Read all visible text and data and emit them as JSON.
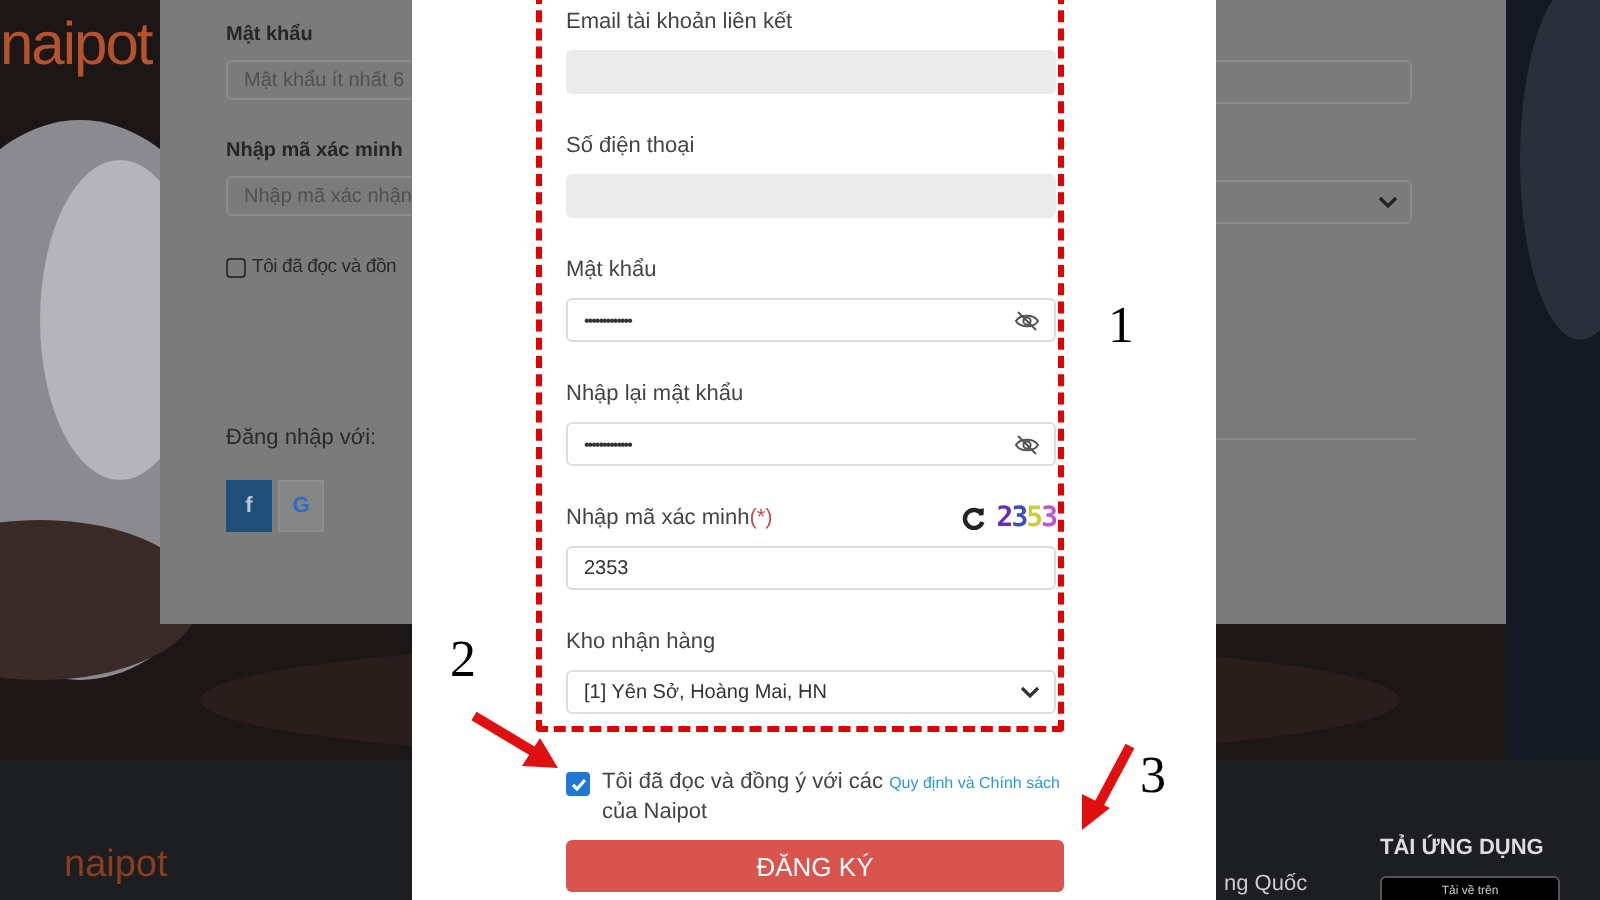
{
  "background_page": {
    "logo": "naipot",
    "form": {
      "fields": [
        {
          "label": "Mật khẩu",
          "placeholder": "Mật khẩu ít nhất 6",
          "kind": "input"
        },
        {
          "label": "Nhập mã xác minh",
          "placeholder": "Nhập mã xác nhận",
          "kind": "select"
        }
      ],
      "agree": {
        "label": "Tôi đã đọc và đồn",
        "checked": false
      },
      "login_with": "Đăng nhập với:",
      "social_buttons": [
        {
          "kind": "facebook",
          "label": "f"
        },
        {
          "kind": "google",
          "label": "G"
        }
      ]
    },
    "footer": {
      "logo": "naipot",
      "text": "ng Quốc",
      "app_heading": "TẢI ỨNG DỤNG",
      "store_button": "Tải về trên"
    }
  },
  "modal": {
    "fields": [
      {
        "label": "Email tài khoản liên kết",
        "kind": "text",
        "disabled": true
      },
      {
        "label": "Số điện thoại",
        "kind": "text",
        "disabled": true
      },
      {
        "label": "Mật khẩu",
        "kind": "password",
        "disabled": false,
        "value": "•••••••••••••"
      },
      {
        "label": "Nhập lại mật khẩu",
        "kind": "password",
        "disabled": false,
        "value": "•••••••••••••"
      },
      {
        "label": "Nhập mã xác minh",
        "required_mark": "(*)",
        "kind": "captcha",
        "disabled": false,
        "value": "2353",
        "captcha": [
          {
            "char": "2",
            "color": "#6a2fb0"
          },
          {
            "char": "3",
            "color": "#3d4fc2"
          },
          {
            "char": "5",
            "color": "#c8d040"
          },
          {
            "char": "3",
            "color": "#c052d6"
          }
        ]
      },
      {
        "label": "Kho nhận hàng",
        "kind": "select",
        "disabled": false,
        "value": "[1] Yên Sở, Hoàng Mai, HN"
      }
    ],
    "agree": {
      "checked": true,
      "text": "Tôi đã đọc và đồng ý với các",
      "link": "Quy định và Chính sách",
      "text_end": "của Naipot"
    },
    "submit": "ĐĂNG KÝ"
  },
  "annotations": [
    {
      "label": "1"
    },
    {
      "label": "2"
    },
    {
      "label": "3"
    }
  ]
}
